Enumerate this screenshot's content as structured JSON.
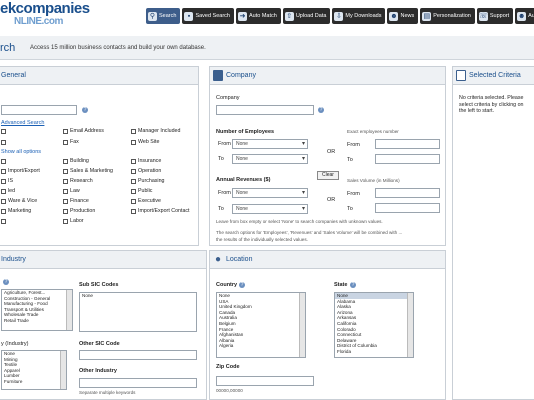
{
  "brand": {
    "line1": "ekcompanies",
    "line2": "NLINE.com"
  },
  "nav": [
    {
      "label": "Search",
      "icon": "magnifier"
    },
    {
      "label": "Saved Search",
      "icon": "disk"
    },
    {
      "label": "Auto Match",
      "icon": "arrow"
    },
    {
      "label": "Upload Data",
      "icon": "upload"
    },
    {
      "label": "My Downloads",
      "icon": "download"
    },
    {
      "label": "News",
      "icon": "user"
    },
    {
      "label": "Personalization",
      "icon": "settings"
    },
    {
      "label": "Support",
      "icon": "support"
    },
    {
      "label": "Au",
      "icon": "user"
    }
  ],
  "page": {
    "title": "rch",
    "subtitle": "Access 15 million business contacts and build your own database."
  },
  "general": {
    "title": "General",
    "link": "Advanced Search",
    "filter_label": "s",
    "section2": "Show all options",
    "checkboxes": [
      [
        "",
        "Email Address",
        "Manager Included"
      ],
      [
        "",
        "Fax",
        "Web Site"
      ],
      [
        "",
        "Building",
        "Insurance"
      ],
      [
        "Import/Export",
        "Sales & Marketing",
        "Operation"
      ],
      [
        "IS",
        "Research",
        "Purchasing"
      ],
      [
        "led",
        "Law",
        "Public"
      ],
      [
        "Ware & Vice",
        "Finance",
        "Executive"
      ],
      [
        "Marketing",
        "Production",
        "Import/Export Contact"
      ],
      [
        "",
        "Labor",
        ""
      ]
    ]
  },
  "company": {
    "title": "Company",
    "company_label": "Company",
    "employees_label": "Number of Employees",
    "or_label": "OR",
    "from_label": "From",
    "to_label": "To",
    "none_label": "None",
    "revenue_label": "Annual Revenues ($)",
    "clear_button": "Clear",
    "sales_hint": "Sales Volume (in Millions)",
    "exact_emp_label": "Exact employees number",
    "from2": "From",
    "to2": "To",
    "note1": "Leave from box empty or select 'None' to search companies with unknown values.",
    "note2": "The search options for 'Employees', 'Revenues' and 'Sales Volume' will be combined with ...",
    "note3": "the results of the individually selected values."
  },
  "selected": {
    "title": "Selected Criteria",
    "text": "No criteria selected. Please select criteria by clicking on the left to start."
  },
  "industry": {
    "title": "Industry",
    "sub_sic_label": "Sub SIC Codes",
    "sub_sic_value": "None",
    "other_sic_label": "Other SIC Code",
    "other_industry_label": "Other Industry",
    "other_industry_hint": "Separate multiple keywords",
    "list1": [
      "Agriculture, Forest...",
      "Construction - General",
      "Manufacturing - Food",
      "Transport & Utilities",
      "Wholesale Trade",
      "Retail Trade"
    ],
    "list2_label": "y (Industry)",
    "list2": [
      "None",
      "Mining",
      "Textile",
      "Apparel",
      "Lumber",
      "Furniture"
    ]
  },
  "location": {
    "title": "Location",
    "country_label": "Country",
    "state_label": "State",
    "zip_label": "Zip Code",
    "zip_hint": "00000,00000",
    "countries": [
      "None",
      "USA",
      "United Kingdom",
      "Canada",
      "Australia",
      "Belgium",
      "France",
      "Afghanistan",
      "Albania",
      "Algeria"
    ],
    "states": [
      "None",
      "Alabama",
      "Alaska",
      "Arizona",
      "Arkansas",
      "California",
      "Colorado",
      "Connecticut",
      "Delaware",
      "District of Columbia",
      "Florida"
    ]
  }
}
